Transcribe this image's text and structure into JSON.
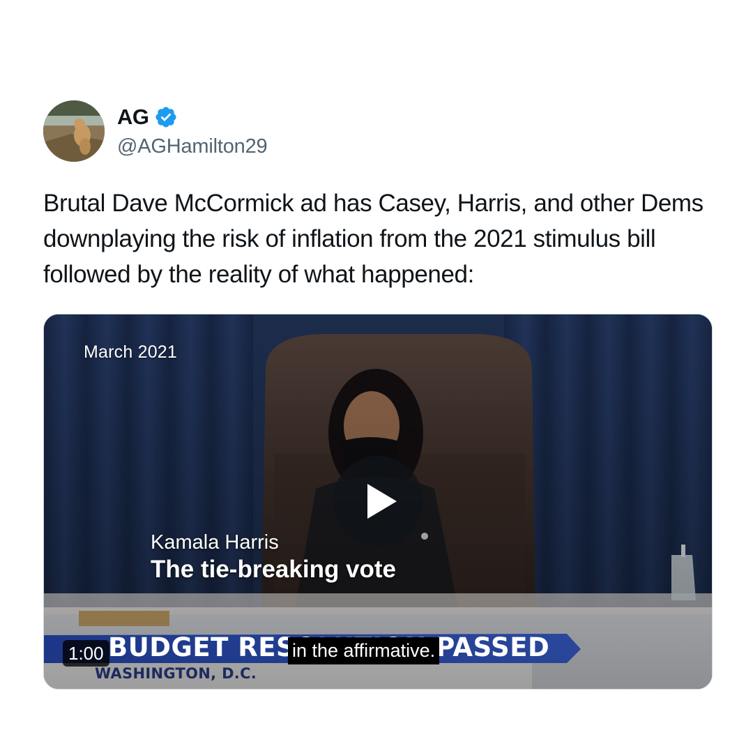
{
  "author": {
    "display_name": "AG",
    "handle": "@AGHamilton29",
    "verified": true,
    "verified_color": "#1d9bf0",
    "avatar": "avatar-photo-dog"
  },
  "tweet": {
    "text": "Brutal Dave McCormick ad has Casey, Harris, and other Dems downplaying the risk of inflation from the 2021 stimulus bill followed by the reality of what happened:"
  },
  "media": {
    "type": "video",
    "duration": "1:00",
    "play_icon": "play-icon",
    "date_caption": "March 2021",
    "speaker_name": "Kamala Harris",
    "speaker_title": "The tie-breaking vote",
    "banner_text": "BUDGET RESOLUTION PASSED",
    "location_text": "WASHINGTON, D.C.",
    "subtitle": "in the affirmative.",
    "banner_color": "#2f55c8"
  }
}
